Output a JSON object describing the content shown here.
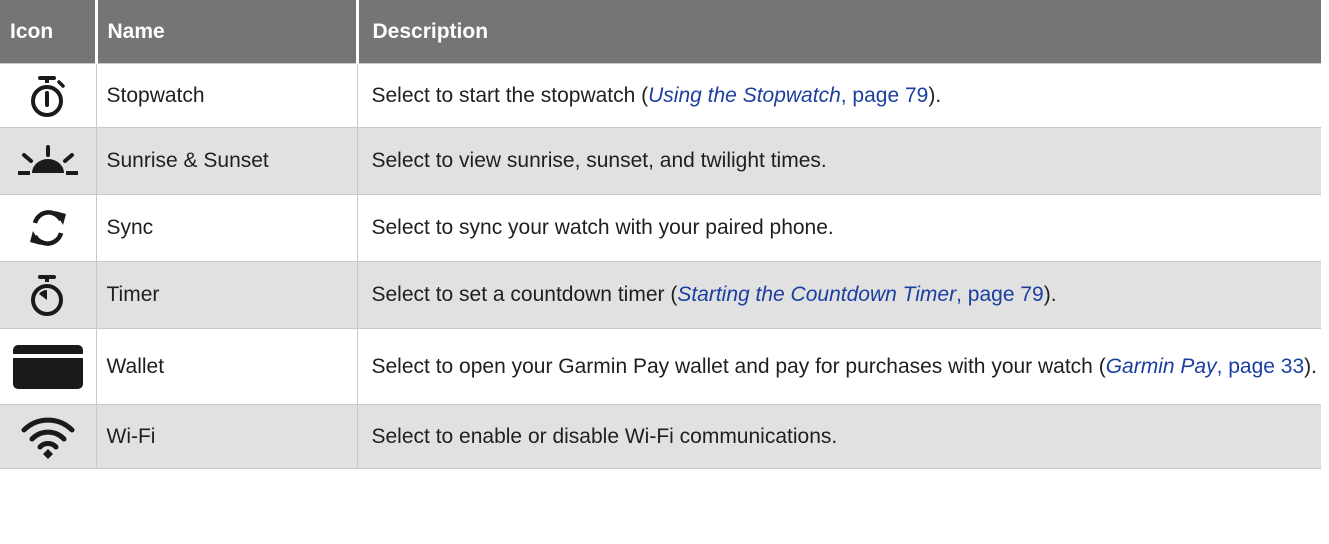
{
  "headers": {
    "icon": "Icon",
    "name": "Name",
    "description": "Description"
  },
  "rows": [
    {
      "icon": "stopwatch-icon",
      "name": "Stopwatch",
      "desc_before": "Select to start the stopwatch (",
      "link_title": "Using the Stopwatch",
      "link_page": ", page 79",
      "desc_after": ")."
    },
    {
      "icon": "sunrise-sunset-icon",
      "name": "Sunrise & Sunset",
      "desc": "Select to view sunrise, sunset, and twilight times."
    },
    {
      "icon": "sync-icon",
      "name": "Sync",
      "desc": "Select to sync your watch with your paired phone."
    },
    {
      "icon": "timer-icon",
      "name": "Timer",
      "desc_before": "Select to set a countdown timer (",
      "link_title": "Starting the Countdown Timer",
      "link_page": ", page 79",
      "desc_after": ")."
    },
    {
      "icon": "wallet-icon",
      "name": "Wallet",
      "desc_before": "Select to open your Garmin Pay wallet and pay for purchases with your watch (",
      "link_title": "Garmin Pay",
      "link_page": ", page 33",
      "desc_after": ")."
    },
    {
      "icon": "wifi-icon",
      "name": "Wi-Fi",
      "desc": "Select to enable or disable Wi-Fi communications."
    }
  ],
  "colors": {
    "header_bg": "#757575",
    "alt_row_bg": "#e1e1e1",
    "link": "#1a3fa0",
    "icon": "#1a1a1a"
  }
}
